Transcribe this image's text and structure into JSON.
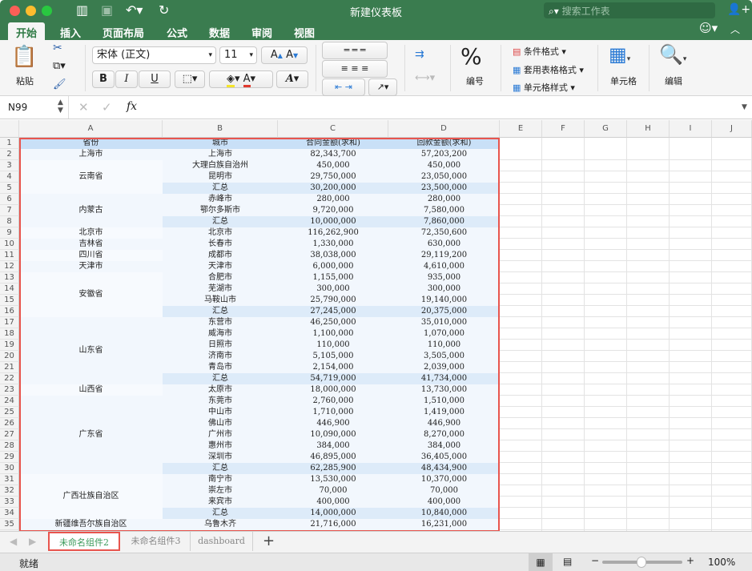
{
  "window": {
    "title": "新建仪表板",
    "search_placeholder": "搜索工作表"
  },
  "tabs": [
    {
      "label": "开始",
      "active": true
    },
    {
      "label": "插入"
    },
    {
      "label": "页面布局"
    },
    {
      "label": "公式"
    },
    {
      "label": "数据"
    },
    {
      "label": "审阅"
    },
    {
      "label": "视图"
    }
  ],
  "ribbon": {
    "paste": "粘贴",
    "font_name": "宋体 (正文)",
    "font_size": "11",
    "bold": "B",
    "italic": "I",
    "underline": "U",
    "number": "编号",
    "percent": "%",
    "cond_format": "条件格式",
    "table_format": "套用表格格式",
    "cell_style": "单元格样式",
    "cells": "单元格",
    "edit": "编辑"
  },
  "formula": {
    "name_box": "N99",
    "fx": "fx",
    "value": ""
  },
  "columns": [
    "A",
    "B",
    "C",
    "D",
    "E",
    "F",
    "G",
    "H",
    "I",
    "J"
  ],
  "table": {
    "headers": [
      "省份",
      "城市",
      "合同金额(求和)",
      "回款金额(求和)"
    ],
    "groups": [
      {
        "province": "上海市",
        "rows": [
          {
            "city": "上海市",
            "contract": "82,343,700",
            "payment": "57,203,200"
          }
        ]
      },
      {
        "province": "云南省",
        "rows": [
          {
            "city": "大理白族自治州",
            "contract": "450,000",
            "payment": "450,000"
          },
          {
            "city": "昆明市",
            "contract": "29,750,000",
            "payment": "23,050,000"
          },
          {
            "city": "汇总",
            "contract": "30,200,000",
            "payment": "23,500,000",
            "subtotal": true
          }
        ]
      },
      {
        "province": "内蒙古",
        "rows": [
          {
            "city": "赤峰市",
            "contract": "280,000",
            "payment": "280,000"
          },
          {
            "city": "鄂尔多斯市",
            "contract": "9,720,000",
            "payment": "7,580,000"
          },
          {
            "city": "汇总",
            "contract": "10,000,000",
            "payment": "7,860,000",
            "subtotal": true
          }
        ]
      },
      {
        "province": "北京市",
        "rows": [
          {
            "city": "北京市",
            "contract": "116,262,900",
            "payment": "72,350,600"
          }
        ]
      },
      {
        "province": "吉林省",
        "rows": [
          {
            "city": "长春市",
            "contract": "1,330,000",
            "payment": "630,000"
          }
        ]
      },
      {
        "province": "四川省",
        "rows": [
          {
            "city": "成都市",
            "contract": "38,038,000",
            "payment": "29,119,200"
          }
        ]
      },
      {
        "province": "天津市",
        "rows": [
          {
            "city": "天津市",
            "contract": "6,000,000",
            "payment": "4,610,000"
          }
        ]
      },
      {
        "province": "安徽省",
        "rows": [
          {
            "city": "合肥市",
            "contract": "1,155,000",
            "payment": "935,000"
          },
          {
            "city": "芜湖市",
            "contract": "300,000",
            "payment": "300,000"
          },
          {
            "city": "马鞍山市",
            "contract": "25,790,000",
            "payment": "19,140,000"
          },
          {
            "city": "汇总",
            "contract": "27,245,000",
            "payment": "20,375,000",
            "subtotal": true
          }
        ]
      },
      {
        "province": "山东省",
        "rows": [
          {
            "city": "东营市",
            "contract": "46,250,000",
            "payment": "35,010,000"
          },
          {
            "city": "威海市",
            "contract": "1,100,000",
            "payment": "1,070,000"
          },
          {
            "city": "日照市",
            "contract": "110,000",
            "payment": "110,000"
          },
          {
            "city": "济南市",
            "contract": "5,105,000",
            "payment": "3,505,000"
          },
          {
            "city": "青岛市",
            "contract": "2,154,000",
            "payment": "2,039,000"
          },
          {
            "city": "汇总",
            "contract": "54,719,000",
            "payment": "41,734,000",
            "subtotal": true
          }
        ]
      },
      {
        "province": "山西省",
        "rows": [
          {
            "city": "太原市",
            "contract": "18,000,000",
            "payment": "13,730,000"
          }
        ]
      },
      {
        "province": "广东省",
        "rows": [
          {
            "city": "东莞市",
            "contract": "2,760,000",
            "payment": "1,510,000"
          },
          {
            "city": "中山市",
            "contract": "1,710,000",
            "payment": "1,419,000"
          },
          {
            "city": "佛山市",
            "contract": "446,900",
            "payment": "446,900"
          },
          {
            "city": "广州市",
            "contract": "10,090,000",
            "payment": "8,270,000"
          },
          {
            "city": "惠州市",
            "contract": "384,000",
            "payment": "384,000"
          },
          {
            "city": "深圳市",
            "contract": "46,895,000",
            "payment": "36,405,000"
          },
          {
            "city": "汇总",
            "contract": "62,285,900",
            "payment": "48,434,900",
            "subtotal": true
          }
        ]
      },
      {
        "province": "广西壮族自治区",
        "rows": [
          {
            "city": "南宁市",
            "contract": "13,530,000",
            "payment": "10,370,000"
          },
          {
            "city": "崇左市",
            "contract": "70,000",
            "payment": "70,000"
          },
          {
            "city": "来宾市",
            "contract": "400,000",
            "payment": "400,000"
          },
          {
            "city": "汇总",
            "contract": "14,000,000",
            "payment": "10,840,000",
            "subtotal": true
          }
        ]
      },
      {
        "province": "新疆维吾尔族自治区",
        "rows": [
          {
            "city": "乌鲁木齐",
            "contract": "21,716,000",
            "payment": "16,231,000"
          }
        ]
      }
    ]
  },
  "sheets": [
    {
      "label": "未命名组件2",
      "active": true
    },
    {
      "label": "未命名组件3"
    },
    {
      "label": "dashboard"
    }
  ],
  "status": {
    "text": "就绪",
    "zoom": "100%"
  },
  "colors": {
    "brand": "#3a7c4f",
    "header_fill": "#c9e0f7",
    "subtotal_fill": "#ddebf9",
    "row_fill": "#f2f7fd",
    "selection": "#e8554e"
  }
}
